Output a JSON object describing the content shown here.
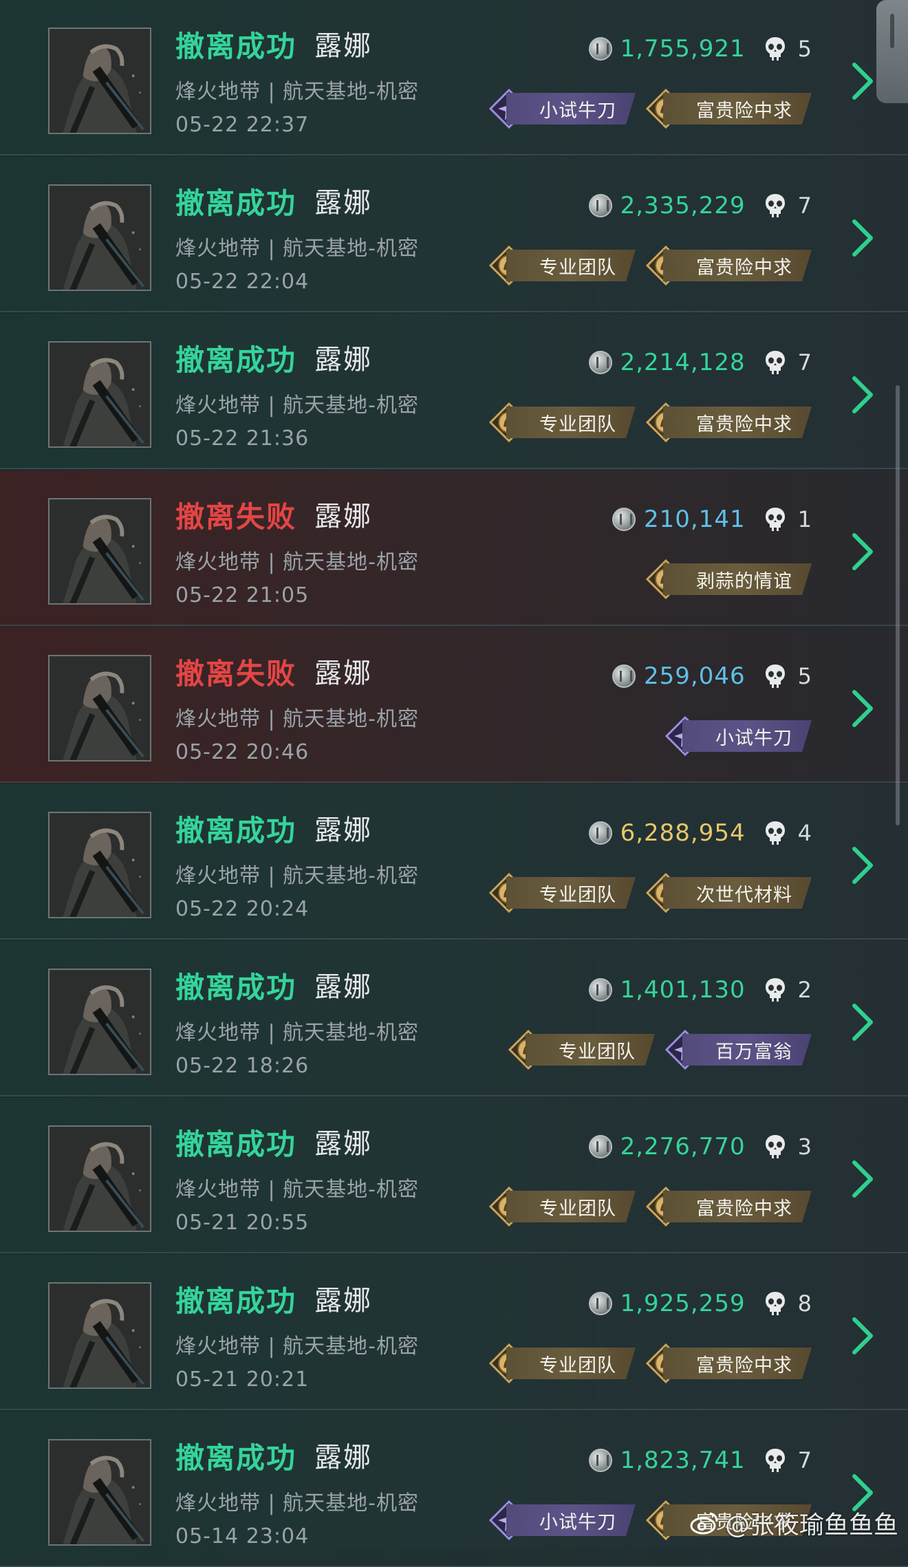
{
  "colors": {
    "success": "#35d49a",
    "fail": "#e44545",
    "value_green": "#35d49a",
    "value_blue": "#5fc0e8",
    "value_gold": "#e8c66a",
    "badge_gold": "#6a5d3e",
    "badge_purple": "#5c5488"
  },
  "watermark": "@张筱瑜鱼鱼鱼",
  "records": [
    {
      "status": "撤离成功",
      "result": "success",
      "name": "露娜",
      "map": "烽火地带 | 航天基地-机密",
      "time": "05-22 22:37",
      "value": "1,755,921",
      "value_color": "green",
      "kills": "5",
      "badges": [
        {
          "type": "purple",
          "label": "小试牛刀",
          "icon": "spiky-crest-icon"
        },
        {
          "type": "gold",
          "label": "富贵险中求",
          "icon": "lion-crest-icon"
        }
      ]
    },
    {
      "status": "撤离成功",
      "result": "success",
      "name": "露娜",
      "map": "烽火地带 | 航天基地-机密",
      "time": "05-22 22:04",
      "value": "2,335,229",
      "value_color": "green",
      "kills": "7",
      "badges": [
        {
          "type": "gold",
          "label": "专业团队",
          "icon": "lion-crest-icon"
        },
        {
          "type": "gold",
          "label": "富贵险中求",
          "icon": "lion-crest-icon"
        }
      ]
    },
    {
      "status": "撤离成功",
      "result": "success",
      "name": "露娜",
      "map": "烽火地带 | 航天基地-机密",
      "time": "05-22 21:36",
      "value": "2,214,128",
      "value_color": "green",
      "kills": "7",
      "badges": [
        {
          "type": "gold",
          "label": "专业团队",
          "icon": "lion-crest-icon"
        },
        {
          "type": "gold",
          "label": "富贵险中求",
          "icon": "lion-crest-icon"
        }
      ]
    },
    {
      "status": "撤离失败",
      "result": "fail",
      "name": "露娜",
      "map": "烽火地带 | 航天基地-机密",
      "time": "05-22 21:05",
      "value": "210,141",
      "value_color": "blue",
      "kills": "1",
      "badges": [
        {
          "type": "gold",
          "label": "剥蒜的情谊",
          "icon": "lion-crest-icon"
        }
      ]
    },
    {
      "status": "撤离失败",
      "result": "fail",
      "name": "露娜",
      "map": "烽火地带 | 航天基地-机密",
      "time": "05-22 20:46",
      "value": "259,046",
      "value_color": "blue",
      "kills": "5",
      "badges": [
        {
          "type": "purple",
          "label": "小试牛刀",
          "icon": "spiky-crest-icon"
        }
      ]
    },
    {
      "status": "撤离成功",
      "result": "success",
      "name": "露娜",
      "map": "烽火地带 | 航天基地-机密",
      "time": "05-22 20:24",
      "value": "6,288,954",
      "value_color": "gold",
      "kills": "4",
      "badges": [
        {
          "type": "gold",
          "label": "专业团队",
          "icon": "lion-crest-icon"
        },
        {
          "type": "gold",
          "label": "次世代材料",
          "icon": "lion-crest-icon"
        }
      ]
    },
    {
      "status": "撤离成功",
      "result": "success",
      "name": "露娜",
      "map": "烽火地带 | 航天基地-机密",
      "time": "05-22 18:26",
      "value": "1,401,130",
      "value_color": "green",
      "kills": "2",
      "badges": [
        {
          "type": "gold",
          "label": "专业团队",
          "icon": "lion-crest-icon"
        },
        {
          "type": "purple",
          "label": "百万富翁",
          "icon": "spiky-crest-icon"
        }
      ]
    },
    {
      "status": "撤离成功",
      "result": "success",
      "name": "露娜",
      "map": "烽火地带 | 航天基地-机密",
      "time": "05-21 20:55",
      "value": "2,276,770",
      "value_color": "green",
      "kills": "3",
      "badges": [
        {
          "type": "gold",
          "label": "专业团队",
          "icon": "lion-crest-icon"
        },
        {
          "type": "gold",
          "label": "富贵险中求",
          "icon": "lion-crest-icon"
        }
      ]
    },
    {
      "status": "撤离成功",
      "result": "success",
      "name": "露娜",
      "map": "烽火地带 | 航天基地-机密",
      "time": "05-21 20:21",
      "value": "1,925,259",
      "value_color": "green",
      "kills": "8",
      "badges": [
        {
          "type": "gold",
          "label": "专业团队",
          "icon": "lion-crest-icon"
        },
        {
          "type": "gold",
          "label": "富贵险中求",
          "icon": "lion-crest-icon"
        }
      ]
    },
    {
      "status": "撤离成功",
      "result": "success",
      "name": "露娜",
      "map": "烽火地带 | 航天基地-机密",
      "time": "05-14 23:04",
      "value": "1,823,741",
      "value_color": "green",
      "kills": "7",
      "badges": [
        {
          "type": "purple",
          "label": "小试牛刀",
          "icon": "spiky-crest-icon"
        },
        {
          "type": "gold",
          "label": "富贵险中求",
          "icon": "lion-crest-icon"
        }
      ]
    }
  ]
}
